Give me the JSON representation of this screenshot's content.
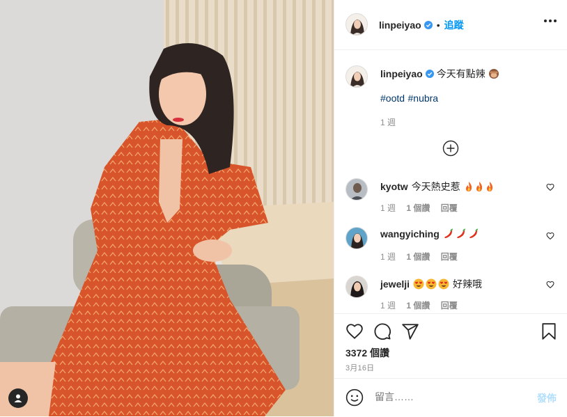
{
  "header": {
    "username": "linpeiyao",
    "follow_label": "追蹤"
  },
  "caption": {
    "username": "linpeiyao",
    "text": "今天有點辣",
    "hashtags": [
      "#ootd",
      "#nubra"
    ],
    "time": "1 週"
  },
  "comments": [
    {
      "username": "kyotw",
      "text": "今天熱史惹",
      "time": "1 週",
      "likes": "1 個讚",
      "reply": "回覆"
    },
    {
      "username": "wangyiching",
      "text": "",
      "time": "1 週",
      "likes": "1 個讚",
      "reply": "回覆"
    },
    {
      "username": "jewelji",
      "text": "好辣哦",
      "time": "1 週",
      "likes": "1 個讚",
      "reply": "回覆"
    }
  ],
  "stats": {
    "likes": "3372 個讚",
    "date": "3月16日"
  },
  "add_comment": {
    "placeholder": "留言……",
    "post_label": "發佈"
  },
  "colors": {
    "accent": "#0095f6",
    "dress": "#d9532a",
    "post_disabled": "#b2dffc"
  }
}
